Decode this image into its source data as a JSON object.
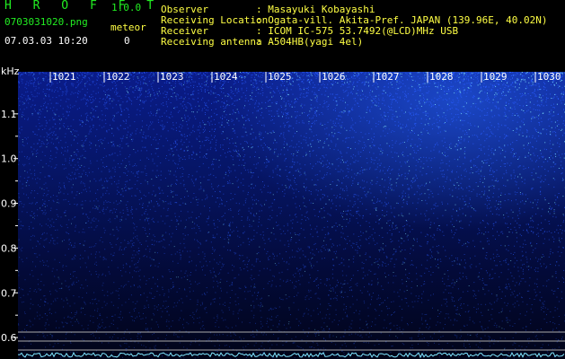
{
  "app": {
    "title": "H R O F F T",
    "version": "1.0.0",
    "file_name": "0703031020.png",
    "datetime": "07.03.03 10:20",
    "meteor_label": "meteor",
    "meteor_count": "0"
  },
  "meta": [
    {
      "label": "Observer",
      "value": ": Masayuki Kobayashi"
    },
    {
      "label": "Receiving Location",
      "value": ": Ogata-vill. Akita-Pref. JAPAN (139.96E, 40.02N)"
    },
    {
      "label": "Receiver",
      "value": ": ICOM IC-575 53.7492(@LCD)MHz USB"
    },
    {
      "label": "Receiving antenna",
      "value": ": A504HB(yagi 4el)"
    }
  ],
  "colors": {
    "accent_green": "#22ee22",
    "accent_yellow": "#ffff44",
    "spectrum_blue": "#2a5cff",
    "spectrum_cyan": "#7fe6ff"
  },
  "waterfall": {
    "y_unit": "kHz",
    "x_labels": [
      "1021",
      "1022",
      "1023",
      "1024",
      "1025",
      "1026",
      "1027",
      "1028",
      "1029",
      "1030"
    ],
    "y_ticks": [
      {
        "label": "1.1",
        "value": 1.1
      },
      {
        "label": "1.0",
        "value": 1.0
      },
      {
        "label": "0.9",
        "value": 0.9
      },
      {
        "label": "0.8",
        "value": 0.8
      },
      {
        "label": "0.7",
        "value": 0.7
      },
      {
        "label": "0.6",
        "value": 0.6
      }
    ],
    "y_range": [
      0.59,
      1.2
    ]
  }
}
